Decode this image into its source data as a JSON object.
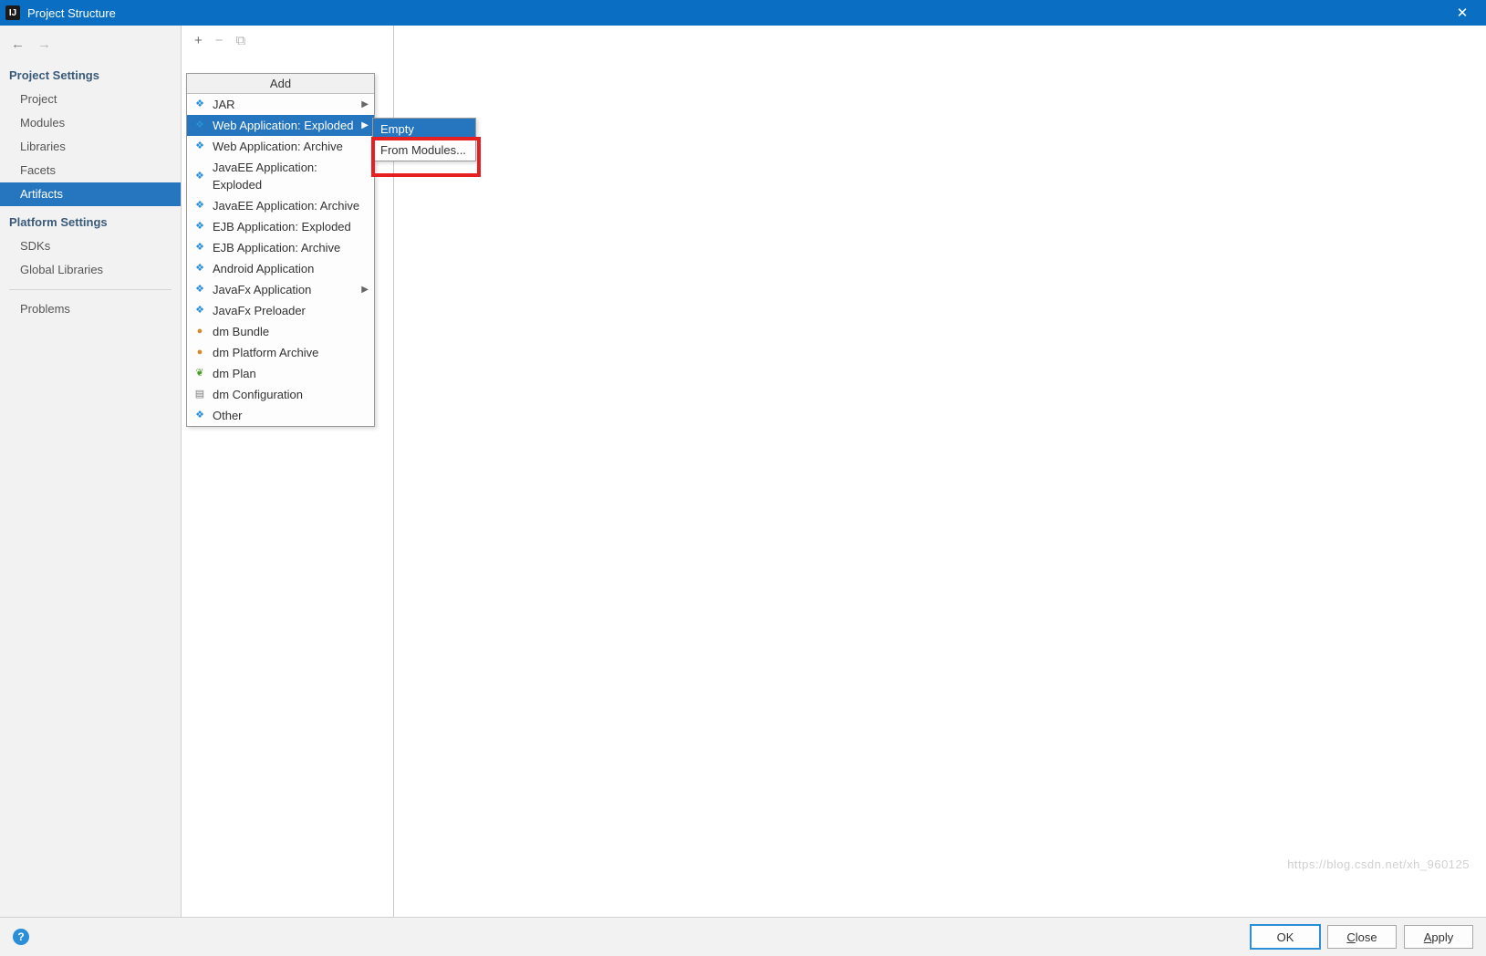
{
  "titlebar": {
    "app_icon_text": "IJ",
    "title": "Project Structure",
    "close_glyph": "✕"
  },
  "nav": {
    "back_glyph": "←",
    "forward_glyph": "→",
    "section_project": "Project Settings",
    "items_project": [
      "Project",
      "Modules",
      "Libraries",
      "Facets",
      "Artifacts"
    ],
    "selected_project_index": 4,
    "section_platform": "Platform Settings",
    "items_platform": [
      "SDKs",
      "Global Libraries"
    ],
    "problems": "Problems"
  },
  "toolbar": {
    "add_glyph": "+",
    "remove_glyph": "−",
    "copy_glyph": "⧉"
  },
  "add_menu": {
    "title": "Add",
    "items": [
      {
        "label": "JAR",
        "icon": "diamond",
        "icon_cls": "ic-blue",
        "submenu": true
      },
      {
        "label": "Web Application: Exploded",
        "icon": "diamond",
        "icon_cls": "ic-blue",
        "submenu": true,
        "selected": true
      },
      {
        "label": "Web Application: Archive",
        "icon": "diamond",
        "icon_cls": "ic-blue"
      },
      {
        "label": "JavaEE Application: Exploded",
        "icon": "diamond",
        "icon_cls": "ic-blue"
      },
      {
        "label": "JavaEE Application: Archive",
        "icon": "diamond",
        "icon_cls": "ic-blue"
      },
      {
        "label": "EJB Application: Exploded",
        "icon": "diamond",
        "icon_cls": "ic-blue"
      },
      {
        "label": "EJB Application: Archive",
        "icon": "diamond",
        "icon_cls": "ic-blue"
      },
      {
        "label": "Android Application",
        "icon": "diamond",
        "icon_cls": "ic-blue"
      },
      {
        "label": "JavaFx Application",
        "icon": "diamond",
        "icon_cls": "ic-blue",
        "submenu": true
      },
      {
        "label": "JavaFx Preloader",
        "icon": "diamond",
        "icon_cls": "ic-blue"
      },
      {
        "label": "dm Bundle",
        "icon": "circle",
        "icon_cls": "ic-orange"
      },
      {
        "label": "dm Platform Archive",
        "icon": "circle",
        "icon_cls": "ic-orange"
      },
      {
        "label": "dm Plan",
        "icon": "leaf",
        "icon_cls": "ic-green"
      },
      {
        "label": "dm Configuration",
        "icon": "doc",
        "icon_cls": "ic-grey"
      },
      {
        "label": "Other",
        "icon": "diamond",
        "icon_cls": "ic-blue"
      }
    ]
  },
  "sub_menu": {
    "items": [
      {
        "label": "Empty",
        "selected": true
      },
      {
        "label": "From Modules..."
      }
    ]
  },
  "footer": {
    "help_glyph": "?",
    "ok": "OK",
    "close": "Close",
    "apply": "Apply"
  },
  "watermark": "https://blog.csdn.net/xh_960125"
}
